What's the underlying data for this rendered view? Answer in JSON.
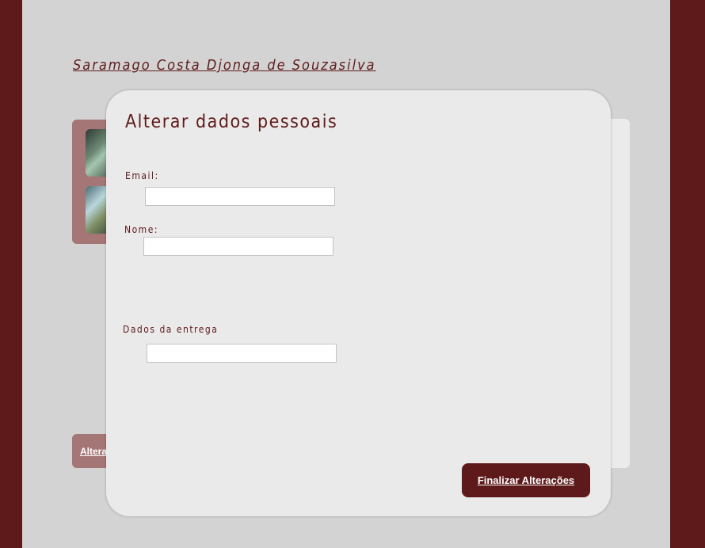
{
  "profile": {
    "user_name": "Saramago Costa Djonga de Souzasilva",
    "background_action_label": "Altera"
  },
  "modal": {
    "title": "Alterar dados pessoais",
    "email": {
      "label": "Email:",
      "value": "",
      "placeholder": ""
    },
    "name": {
      "label": "Nome:",
      "value": "",
      "placeholder": ""
    },
    "delivery": {
      "label": "Dados da entrega",
      "value": "",
      "placeholder": ""
    },
    "submit_label": "Finalizar Alterações"
  },
  "colors": {
    "brand": "#5e1a1a",
    "page_background": "#d3d3d3",
    "modal_background": "#eaeaea",
    "muted_panel": "#a57676"
  }
}
